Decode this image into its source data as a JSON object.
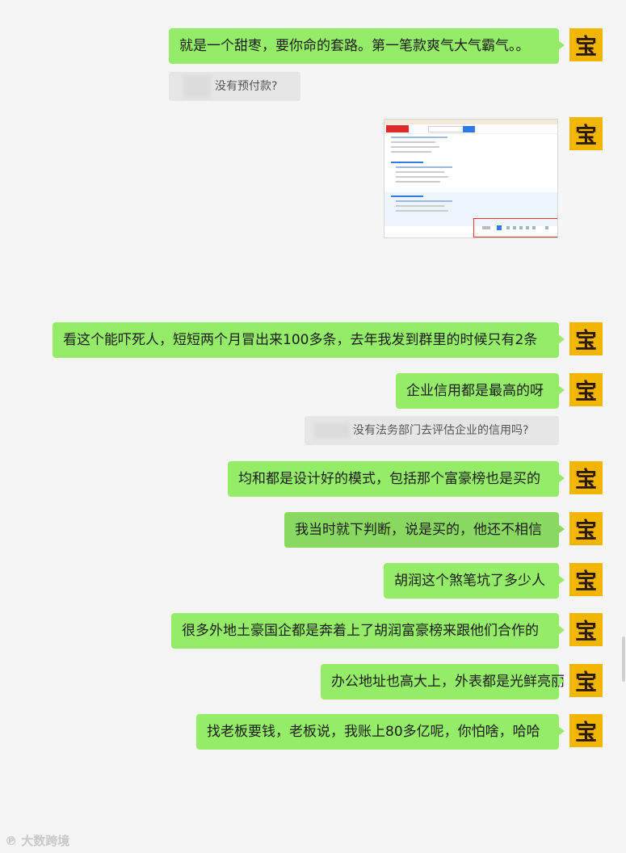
{
  "avatar_char": "宝",
  "messages": [
    {
      "text": "就是一个甜枣，要你命的套路。第一笔款爽气大气霸气。。"
    },
    {
      "text": "看这个能吓死人，短短两个月冒出来100多条，去年我发到群里的时候只有2条"
    },
    {
      "text": "企业信用都是最高的呀"
    },
    {
      "text": "均和都是设计好的模式，包括那个富豪榜也是买的"
    },
    {
      "text": "我当时就下判断，说是买的，他还不相信"
    },
    {
      "text": "胡润这个煞笔坑了多少人"
    },
    {
      "text": "很多外地土豪国企都是奔着上了胡润富豪榜来跟他们合作的"
    },
    {
      "text": "办公地址也高大上，外表都是光鲜亮丽"
    },
    {
      "text": "找老板要钱，老板说，我账上80多亿呢，你怕啥，哈哈"
    }
  ],
  "quotes": [
    {
      "text": "没有预付款?"
    },
    {
      "text": "没有法务部门去评估企业的信用吗?"
    }
  ],
  "watermark": "大数跨境"
}
